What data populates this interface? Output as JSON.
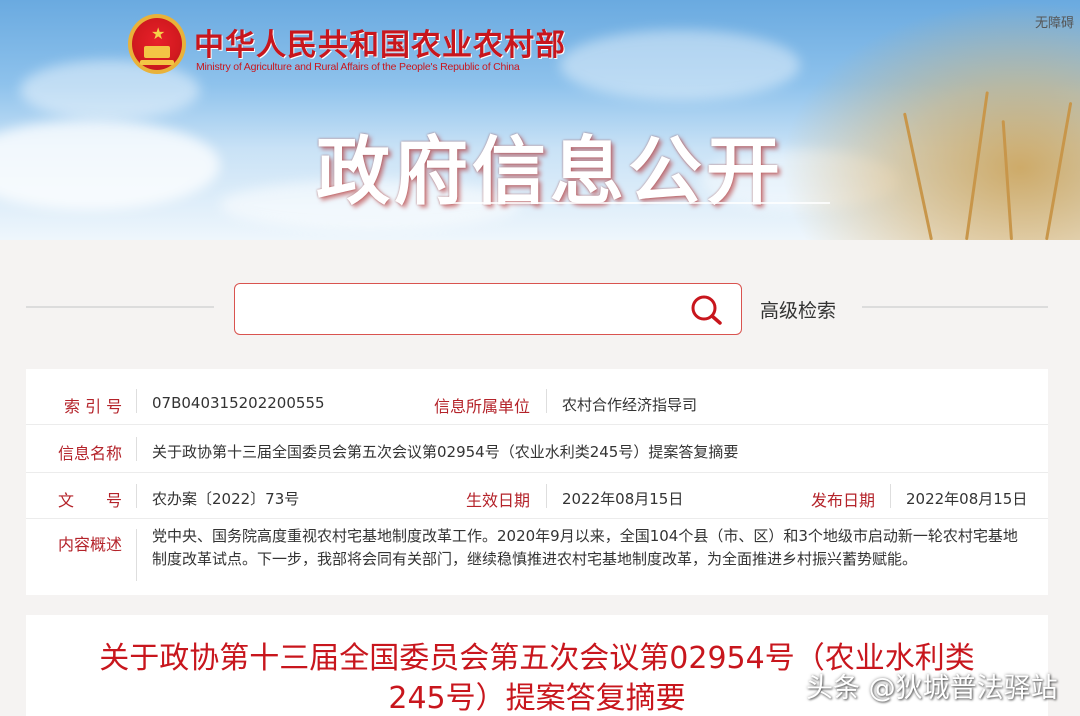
{
  "header": {
    "ministry_cn": "中华人民共和国农业农村部",
    "ministry_en": "Ministry of Agriculture and Rural Affairs of the People's Republic of China",
    "accessibility": "无障碍",
    "section_title": "政府信息公开",
    "emblem_icon": "national-emblem"
  },
  "search": {
    "placeholder": "",
    "advanced_label": "高级检索",
    "icon": "search-icon"
  },
  "meta": {
    "index_label": "索 引 号",
    "index_value": "07B040315202200555",
    "unit_label": "信息所属单位",
    "unit_value": "农村合作经济指导司",
    "name_label": "信息名称",
    "name_value": "关于政协第十三届全国委员会第五次会议第02954号（农业水利类245号）提案答复摘要",
    "doc_label": "文　　号",
    "doc_value": "农办案〔2022〕73号",
    "effective_label": "生效日期",
    "effective_value": "2022年08月15日",
    "publish_label": "发布日期",
    "publish_value": "2022年08月15日",
    "summary_label": "内容概述",
    "summary_value": "党中央、国务院高度重视农村宅基地制度改革工作。2020年9月以来，全国104个县（市、区）和3个地级市启动新一轮农村宅基地制度改革试点。下一步，我部将会同有关部门，继续稳慎推进农村宅基地制度改革，为全面推进乡村振兴蓄势赋能。"
  },
  "article": {
    "title_line1": "关于政协第十三届全国委员会第五次会议第02954号（农业水利类",
    "title_line2": "245号）提案答复摘要"
  },
  "watermark": "头条 @狄城普法驿站",
  "colors": {
    "accent_red": "#c8161d",
    "label_red": "#b4232a",
    "search_border": "#d9534f"
  }
}
